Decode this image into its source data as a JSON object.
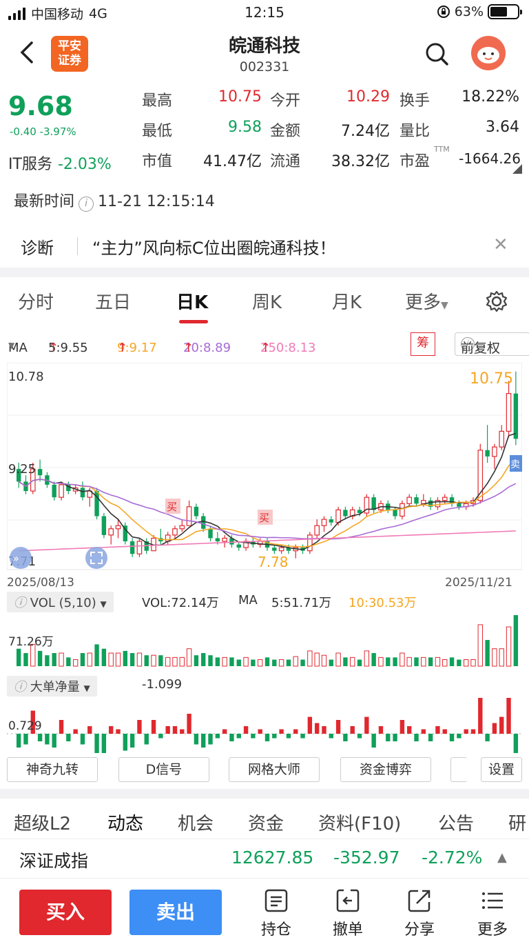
{
  "status_bar": {
    "carrier": "中国移动",
    "network": "4G",
    "time": "12:15",
    "battery_pct": "63%",
    "battery_level": 0.63
  },
  "header": {
    "logo_line1": "平安",
    "logo_line2": "证券",
    "title": "皖通科技",
    "code": "002331"
  },
  "quote": {
    "price": "9.68",
    "change": "-0.40 -3.97%",
    "sector_name": "IT服务",
    "sector_change": "-2.03%",
    "rows": [
      [
        {
          "l": "最高",
          "v": "10.75",
          "c": "red"
        },
        {
          "l": "今开",
          "v": "10.29",
          "c": "red"
        },
        {
          "l": "换手",
          "v": "18.22%",
          "c": "dark"
        }
      ],
      [
        {
          "l": "最低",
          "v": "9.58",
          "c": "green"
        },
        {
          "l": "金额",
          "v": "7.24亿",
          "c": "dark"
        },
        {
          "l": "量比",
          "v": "3.64",
          "c": "dark"
        }
      ],
      [
        {
          "l": "市值",
          "v": "41.47亿",
          "c": "dark"
        },
        {
          "l": "流通",
          "v": "38.32亿",
          "c": "dark"
        },
        {
          "l": "市盈",
          "sup": "TTM",
          "v": "-1664.26",
          "c": "dark"
        }
      ]
    ]
  },
  "timeline": {
    "label": "最新时间",
    "value": "11-21 12:15:14"
  },
  "diagnosis": {
    "label": "诊断",
    "text": "“主力”风向标C位出圈皖通科技！"
  },
  "tabs": [
    "分时",
    "五日",
    "日K",
    "周K",
    "月K",
    "更多"
  ],
  "active_tab": "日K",
  "ma": {
    "name": "MA",
    "ma5": "5:9.55",
    "ma9": "9:9.17",
    "ma20": "20:8.89",
    "ma250": "250:8.13",
    "chou": "筹",
    "fuquan": "前复权"
  },
  "kline": {
    "y_top": "10.78",
    "y_mid": "9.25",
    "y_bottom": "7.71",
    "date_start": "2025/08/13",
    "date_end": "2025/11/21",
    "high_label": "10.75",
    "low_label": "7.78",
    "buy_marker": "买",
    "sell_marker": "卖"
  },
  "vol": {
    "selector": "VOL (5,10)",
    "vol_value": "VOL:72.14万",
    "ma_label": "MA",
    "ma5": "5:51.71万",
    "ma10": "10:30.53万",
    "y_label": "71.26万"
  },
  "dadan": {
    "selector": "大单净量",
    "value": "-1.099",
    "y_label": "0.729"
  },
  "indicators": [
    "神奇九转",
    "D信号",
    "网格大师",
    "资金博弈",
    "",
    "设置"
  ],
  "bottom_tabs": [
    "超级L2",
    "动态",
    "机会",
    "资金",
    "资料(F10)",
    "公告",
    "研"
  ],
  "index": {
    "name": "深证成指",
    "value": "12627.85",
    "change": "-352.97",
    "pct": "-2.72%"
  },
  "actions": {
    "buy": "买入",
    "sell": "卖出",
    "hold": "持仓",
    "cancel": "撤单",
    "share": "分享",
    "more": "更多"
  },
  "colors": {
    "up": "#e0282e",
    "down": "#0fa05a",
    "ma5": "#333333",
    "ma9": "#f5a623",
    "ma20": "#a66bd6",
    "ma250": "#f07ab6"
  },
  "chart_data": {
    "type": "candlestick",
    "price_range": [
      7.71,
      10.78
    ],
    "candles_ohlc": [
      [
        9.2,
        9.3,
        8.9,
        9.0
      ],
      [
        9.0,
        9.1,
        8.8,
        8.85
      ],
      [
        8.85,
        9.3,
        8.8,
        9.2
      ],
      [
        9.2,
        9.35,
        9.0,
        9.1
      ],
      [
        9.1,
        9.15,
        8.9,
        8.95
      ],
      [
        8.95,
        9.0,
        8.7,
        8.75
      ],
      [
        8.75,
        9.0,
        8.7,
        8.95
      ],
      [
        8.95,
        9.0,
        8.8,
        8.85
      ],
      [
        8.85,
        8.95,
        8.8,
        8.9
      ],
      [
        8.9,
        9.0,
        8.7,
        8.75
      ],
      [
        8.75,
        8.9,
        8.6,
        8.85
      ],
      [
        8.85,
        8.9,
        8.4,
        8.45
      ],
      [
        8.45,
        8.5,
        8.1,
        8.15
      ],
      [
        8.15,
        8.3,
        8.0,
        8.25
      ],
      [
        8.25,
        8.4,
        8.1,
        8.3
      ],
      [
        8.3,
        8.35,
        8.0,
        8.05
      ],
      [
        8.05,
        8.1,
        7.8,
        7.85
      ],
      [
        7.85,
        8.1,
        7.8,
        8.05
      ],
      [
        8.05,
        8.1,
        7.85,
        7.9
      ],
      [
        7.9,
        8.15,
        7.9,
        8.1
      ],
      [
        8.1,
        8.25,
        8.0,
        8.05
      ],
      [
        8.05,
        8.2,
        8.0,
        8.15
      ],
      [
        8.15,
        8.3,
        8.1,
        8.25
      ],
      [
        8.25,
        8.4,
        8.2,
        8.3
      ],
      [
        8.3,
        8.7,
        8.3,
        8.6
      ],
      [
        8.6,
        8.65,
        8.4,
        8.45
      ],
      [
        8.45,
        8.5,
        8.2,
        8.25
      ],
      [
        8.25,
        8.3,
        8.05,
        8.1
      ],
      [
        8.1,
        8.2,
        8.0,
        8.05
      ],
      [
        8.05,
        8.15,
        7.95,
        8.1
      ],
      [
        8.1,
        8.15,
        7.95,
        8.0
      ],
      [
        8.0,
        8.05,
        7.9,
        7.95
      ],
      [
        7.95,
        8.1,
        7.9,
        8.05
      ],
      [
        8.05,
        8.1,
        7.95,
        8.0
      ],
      [
        8.0,
        8.1,
        7.95,
        8.05
      ],
      [
        8.05,
        8.1,
        7.9,
        7.95
      ],
      [
        7.95,
        8.0,
        7.85,
        7.9
      ],
      [
        7.9,
        8.0,
        7.85,
        7.95
      ],
      [
        7.95,
        8.0,
        7.85,
        7.9
      ],
      [
        7.9,
        8.0,
        7.78,
        7.95
      ],
      [
        7.95,
        8.0,
        7.85,
        7.9
      ],
      [
        7.9,
        8.2,
        7.85,
        8.15
      ],
      [
        8.15,
        8.4,
        8.1,
        8.3
      ],
      [
        8.3,
        8.45,
        8.2,
        8.4
      ],
      [
        8.4,
        8.45,
        8.3,
        8.35
      ],
      [
        8.35,
        8.6,
        8.3,
        8.55
      ],
      [
        8.55,
        8.6,
        8.4,
        8.45
      ],
      [
        8.45,
        8.6,
        8.4,
        8.55
      ],
      [
        8.55,
        8.6,
        8.45,
        8.5
      ],
      [
        8.5,
        8.8,
        8.45,
        8.75
      ],
      [
        8.75,
        8.8,
        8.5,
        8.55
      ],
      [
        8.55,
        8.7,
        8.5,
        8.65
      ],
      [
        8.65,
        8.7,
        8.5,
        8.55
      ],
      [
        8.55,
        8.6,
        8.4,
        8.45
      ],
      [
        8.45,
        8.7,
        8.4,
        8.65
      ],
      [
        8.65,
        8.8,
        8.6,
        8.75
      ],
      [
        8.75,
        8.8,
        8.6,
        8.65
      ],
      [
        8.65,
        8.8,
        8.6,
        8.7
      ],
      [
        8.7,
        8.75,
        8.55,
        8.6
      ],
      [
        8.6,
        8.75,
        8.55,
        8.7
      ],
      [
        8.7,
        8.8,
        8.65,
        8.75
      ],
      [
        8.75,
        8.8,
        8.6,
        8.65
      ],
      [
        8.65,
        8.7,
        8.55,
        8.6
      ],
      [
        8.6,
        8.7,
        8.55,
        8.65
      ],
      [
        8.65,
        8.75,
        8.6,
        8.7
      ],
      [
        8.7,
        9.6,
        8.65,
        9.5
      ],
      [
        9.5,
        9.9,
        9.3,
        9.4
      ],
      [
        9.4,
        9.6,
        9.2,
        9.55
      ],
      [
        9.55,
        9.9,
        9.5,
        9.8
      ],
      [
        9.8,
        10.6,
        9.7,
        10.4
      ],
      [
        10.4,
        10.75,
        9.58,
        9.68
      ]
    ]
  }
}
